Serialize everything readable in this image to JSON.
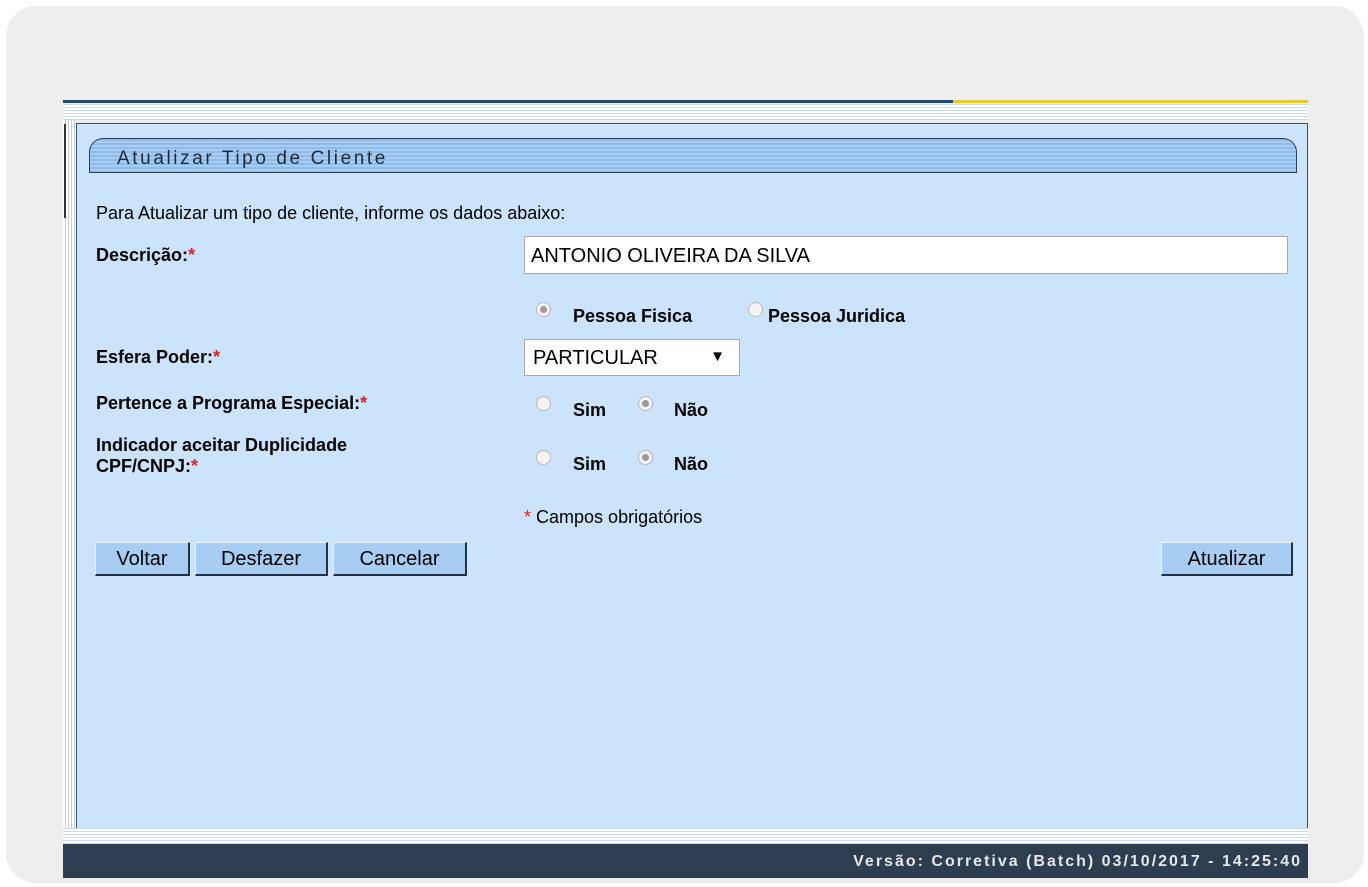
{
  "page": {
    "title": "Atualizar Tipo de Cliente",
    "instruction": "Para Atualizar um tipo de cliente, informe os dados abaixo:"
  },
  "form": {
    "descricao": {
      "label": "Descrição:",
      "value": "ANTONIO OLIVEIRA DA SILVA"
    },
    "tipo_pessoa": {
      "options": [
        "Pessoa Fisica",
        "Pessoa Juridica"
      ],
      "selected": "Pessoa Fisica"
    },
    "esfera_poder": {
      "label": "Esfera Poder:",
      "value": "PARTICULAR"
    },
    "programa_especial": {
      "label": "Pertence a Programa Especial:",
      "options": [
        "Sim",
        "Não"
      ],
      "selected": "Não"
    },
    "duplicidade": {
      "label_line1": "Indicador aceitar Duplicidade",
      "label_line2": "CPF/CNPJ:",
      "options": [
        "Sim",
        "Não"
      ],
      "selected": "Não"
    },
    "required_star": "*",
    "required_note": "Campos obrigatórios"
  },
  "buttons": {
    "voltar": "Voltar",
    "desfazer": "Desfazer",
    "cancelar": "Cancelar",
    "atualizar": "Atualizar"
  },
  "footer": {
    "version": "Versão: Corretiva (Batch) 03/10/2017 - 14:25:40"
  }
}
